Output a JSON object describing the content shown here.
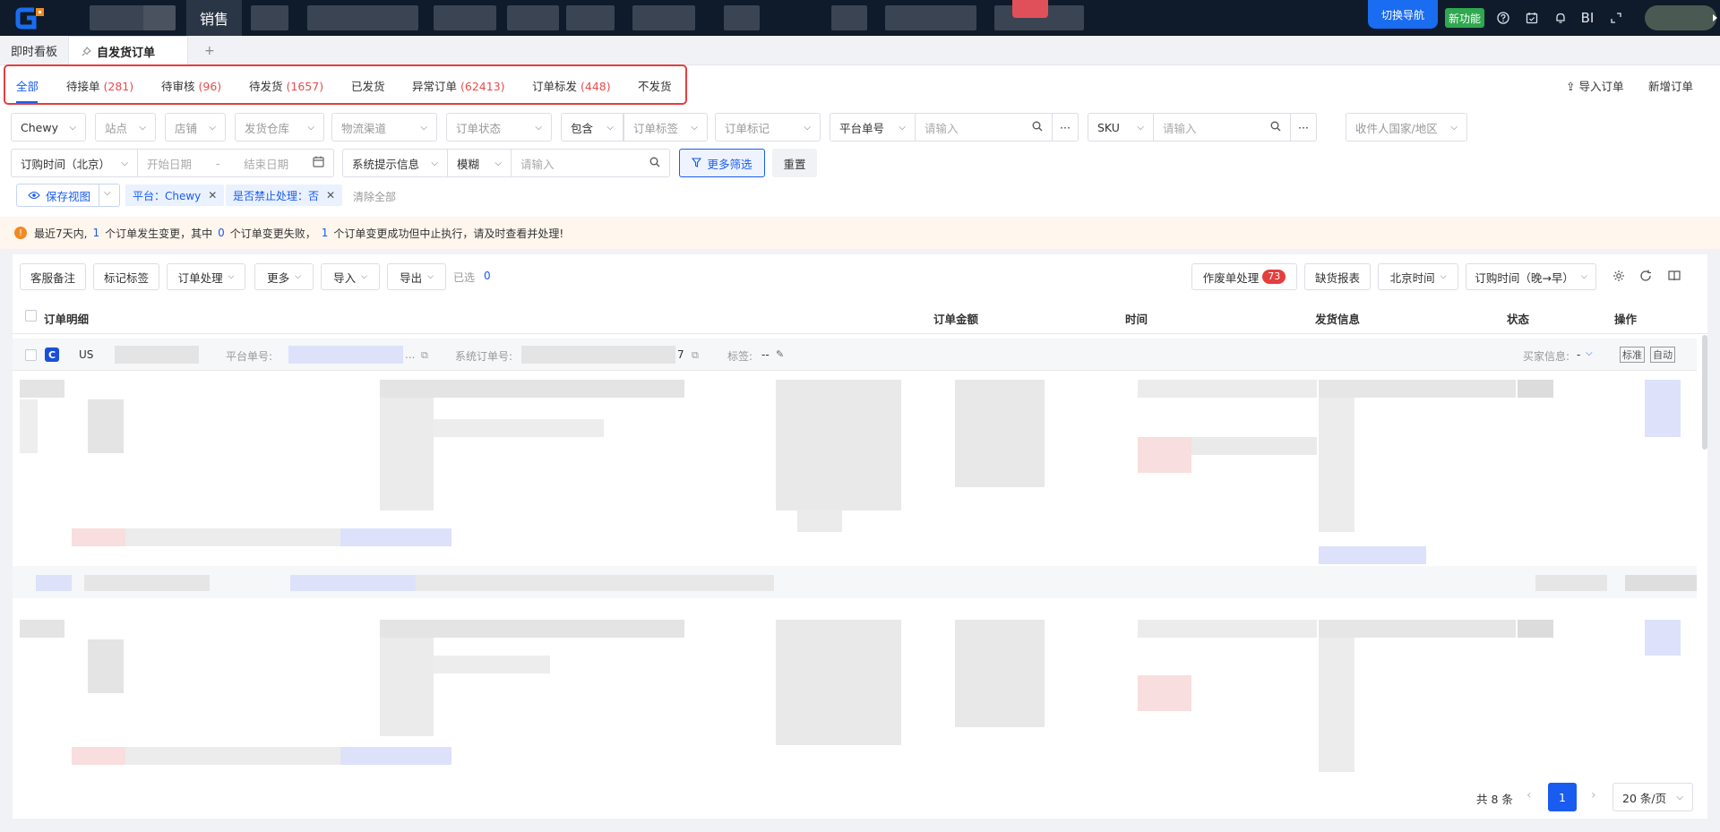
{
  "topnav": {
    "menu_active": "销售",
    "switch_nav": "切换导航",
    "new_feature": "新功能",
    "icons": [
      "help-icon",
      "calendar-check-icon",
      "bell-icon",
      "bi-icon",
      "fullscreen-icon"
    ],
    "bi_label": "BI"
  },
  "pagetabs": {
    "items": [
      "即时看板",
      "自发货订单"
    ],
    "add": "+"
  },
  "status_tabs": [
    {
      "label": "全部",
      "count": ""
    },
    {
      "label": "待接单",
      "count": "(281)"
    },
    {
      "label": "待审核",
      "count": "(96)"
    },
    {
      "label": "待发货",
      "count": "(1657)"
    },
    {
      "label": "已发货",
      "count": ""
    },
    {
      "label": "异常订单",
      "count": "(62413)"
    },
    {
      "label": "订单标发",
      "count": "(448)"
    },
    {
      "label": "不发货",
      "count": ""
    }
  ],
  "actions": {
    "import_order": "导入订单",
    "new_order": "新增订单"
  },
  "filters": {
    "platform": "Chewy",
    "site": "站点",
    "store": "店铺",
    "warehouse": "发货仓库",
    "logistics": "物流渠道",
    "order_status": "订单状态",
    "contains": "包含",
    "order_tag": "订单标签",
    "order_mark": "订单标记",
    "platform_no": "平台单号",
    "platform_no_placeholder": "请输入",
    "sku": "SKU",
    "sku_placeholder": "请输入",
    "recipient_country": "收件人国家/地区",
    "time_type": "订购时间（北京）",
    "start_date": "开始日期",
    "date_sep": "-",
    "end_date": "结束日期",
    "sys_info": "系统提示信息",
    "fuzzy": "模糊",
    "sys_placeholder": "请输入",
    "more_filter": "更多筛选",
    "reset": "重置",
    "more_dots": "···"
  },
  "view": {
    "save_view": "保存视图",
    "tags": [
      "平台：Chewy",
      "是否禁止处理：否"
    ],
    "clear_all": "清除全部"
  },
  "notice": {
    "t1": "最近7天内,",
    "n1": "1",
    "t2": "个订单发生变更，其中",
    "n2": "0",
    "t3": "个订单变更失败，",
    "n3": "1",
    "t4": "个订单变更成功但中止执行，请及时查看并处理!"
  },
  "toolbar": {
    "service_note": "客服备注",
    "mark_tag": "标记标签",
    "order_process": "订单处理",
    "more": "更多",
    "import": "导入",
    "export": "导出",
    "selected_label": "已选",
    "selected_count": "0",
    "void_process": "作废单处理",
    "void_count": "73",
    "stock_report": "缺货报表",
    "timezone": "北京时间",
    "sort": "订购时间（晚→早）"
  },
  "table": {
    "headers": [
      "订单明细",
      "订单金额",
      "时间",
      "发货信息",
      "状态",
      "操作"
    ],
    "row": {
      "country": "US",
      "platform_no_label": "平台单号:",
      "sys_no_label": "系统订单号:",
      "sys_no_suffix": "7",
      "tag_label": "标签:",
      "tag_value": "--",
      "buyer_info": "买家信息:",
      "buyer_value": "-",
      "std": "标准",
      "auto": "自动",
      "ellipsis": "..."
    }
  },
  "pager": {
    "total": "共 8 条",
    "current": "1",
    "size": "20 条/页"
  }
}
